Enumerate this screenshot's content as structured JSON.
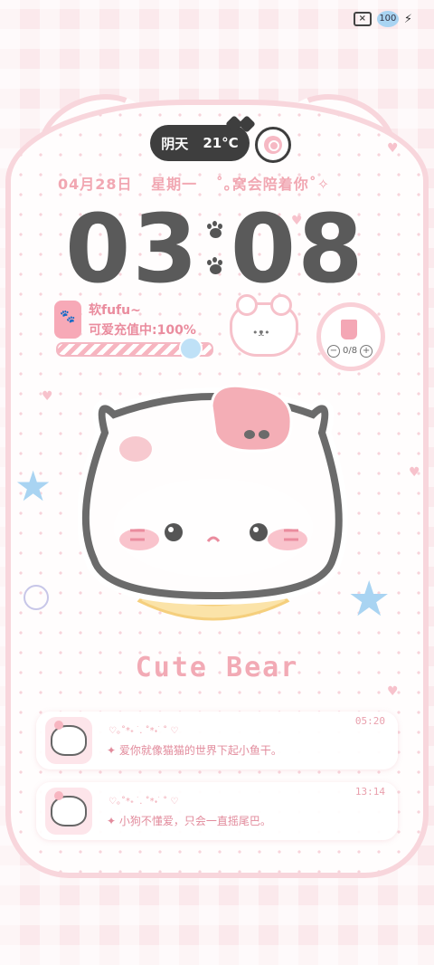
{
  "status_bar": {
    "battery_level": "100",
    "sim_icon": "sim-off-icon",
    "charging_icon": "bolt-icon"
  },
  "weather": {
    "condition": "阴天",
    "temperature": "21°C"
  },
  "date_line": {
    "date": "04月28日",
    "weekday": "星期一",
    "message": "˚｡窝会陪着你˚✧"
  },
  "clock": {
    "hours": "03",
    "minutes": "08"
  },
  "battery_widget": {
    "name": "软fufu~",
    "status": "可爱充值中:100%",
    "level_percent": 100
  },
  "water_widget": {
    "minus_label": "−",
    "count": "0/8",
    "plus_label": "+"
  },
  "title": "Cute Bear",
  "notifications": [
    {
      "deco": "♡｡˚*˖ ࣪ . ˚*˖ ࣪ ˚ ♡",
      "time": "05:20",
      "message": "✦ 爱你就像猫猫的世界下起小鱼干。"
    },
    {
      "deco": "♡｡˚*˖ ࣪ . ˚*˖ ࣪ ˚ ♡",
      "time": "13:14",
      "message": "✦ 小狗不懂爱，只会一直摇尾巴。"
    }
  ],
  "colors": {
    "accent_pink": "#f1a7b2",
    "dark": "#3e3e3e",
    "blue_star": "#a9d4f2"
  }
}
